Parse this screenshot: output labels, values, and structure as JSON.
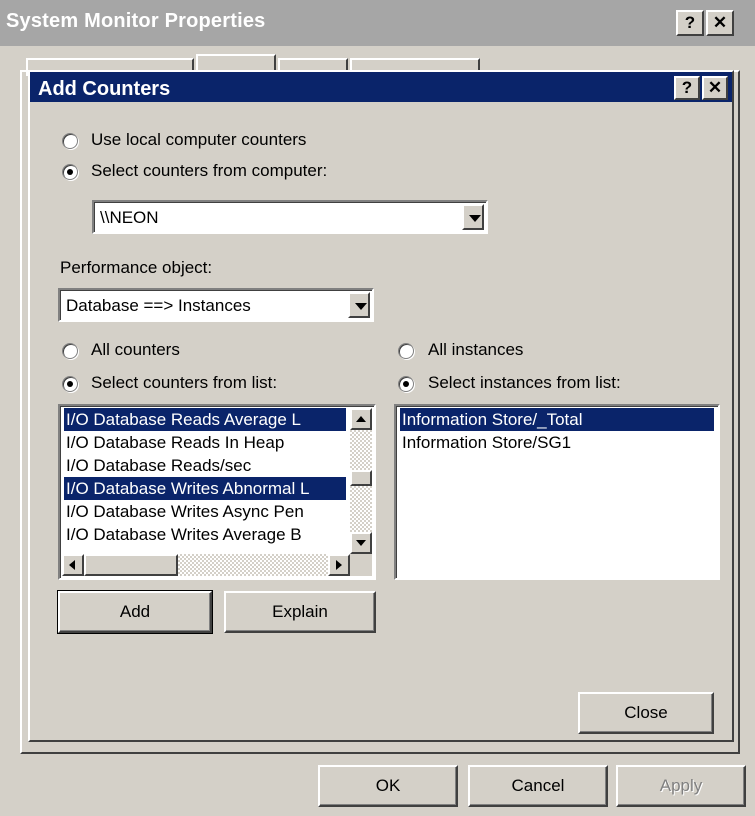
{
  "outer_window": {
    "title": "System Monitor Properties",
    "help_glyph": "?",
    "close_glyph": "✕",
    "buttons": {
      "ok": "OK",
      "cancel": "Cancel",
      "apply": "Apply"
    }
  },
  "dialog": {
    "title": "Add Counters",
    "help_glyph": "?",
    "close_glyph": "✕",
    "source": {
      "local_label": "Use local computer counters",
      "remote_label": "Select counters from computer:",
      "selected": "remote",
      "computer_value": "\\\\NEON"
    },
    "performance_object": {
      "label": "Performance object:",
      "value": "Database ==> Instances"
    },
    "counters": {
      "all_label": "All counters",
      "select_label": "Select counters from list:",
      "selected_mode": "select",
      "items": [
        {
          "text": "I/O Database Reads Average L",
          "selected": true
        },
        {
          "text": "I/O Database Reads In Heap",
          "selected": false
        },
        {
          "text": "I/O Database Reads/sec",
          "selected": false
        },
        {
          "text": "I/O Database Writes Abnormal L",
          "selected": true
        },
        {
          "text": "I/O Database Writes Async Pen",
          "selected": false
        },
        {
          "text": "I/O Database Writes Average B",
          "selected": false
        }
      ]
    },
    "instances": {
      "all_label": "All instances",
      "select_label": "Select instances from list:",
      "selected_mode": "select",
      "items": [
        {
          "text": "Information Store/_Total",
          "selected": true
        },
        {
          "text": "Information Store/SG1",
          "selected": false
        }
      ]
    },
    "buttons": {
      "add": "Add",
      "explain": "Explain",
      "close": "Close"
    }
  },
  "colors": {
    "face": "#d4d0c8",
    "active_title": "#0a246a",
    "inactive_title": "#a6a6a6",
    "selection": "#0a246a"
  }
}
